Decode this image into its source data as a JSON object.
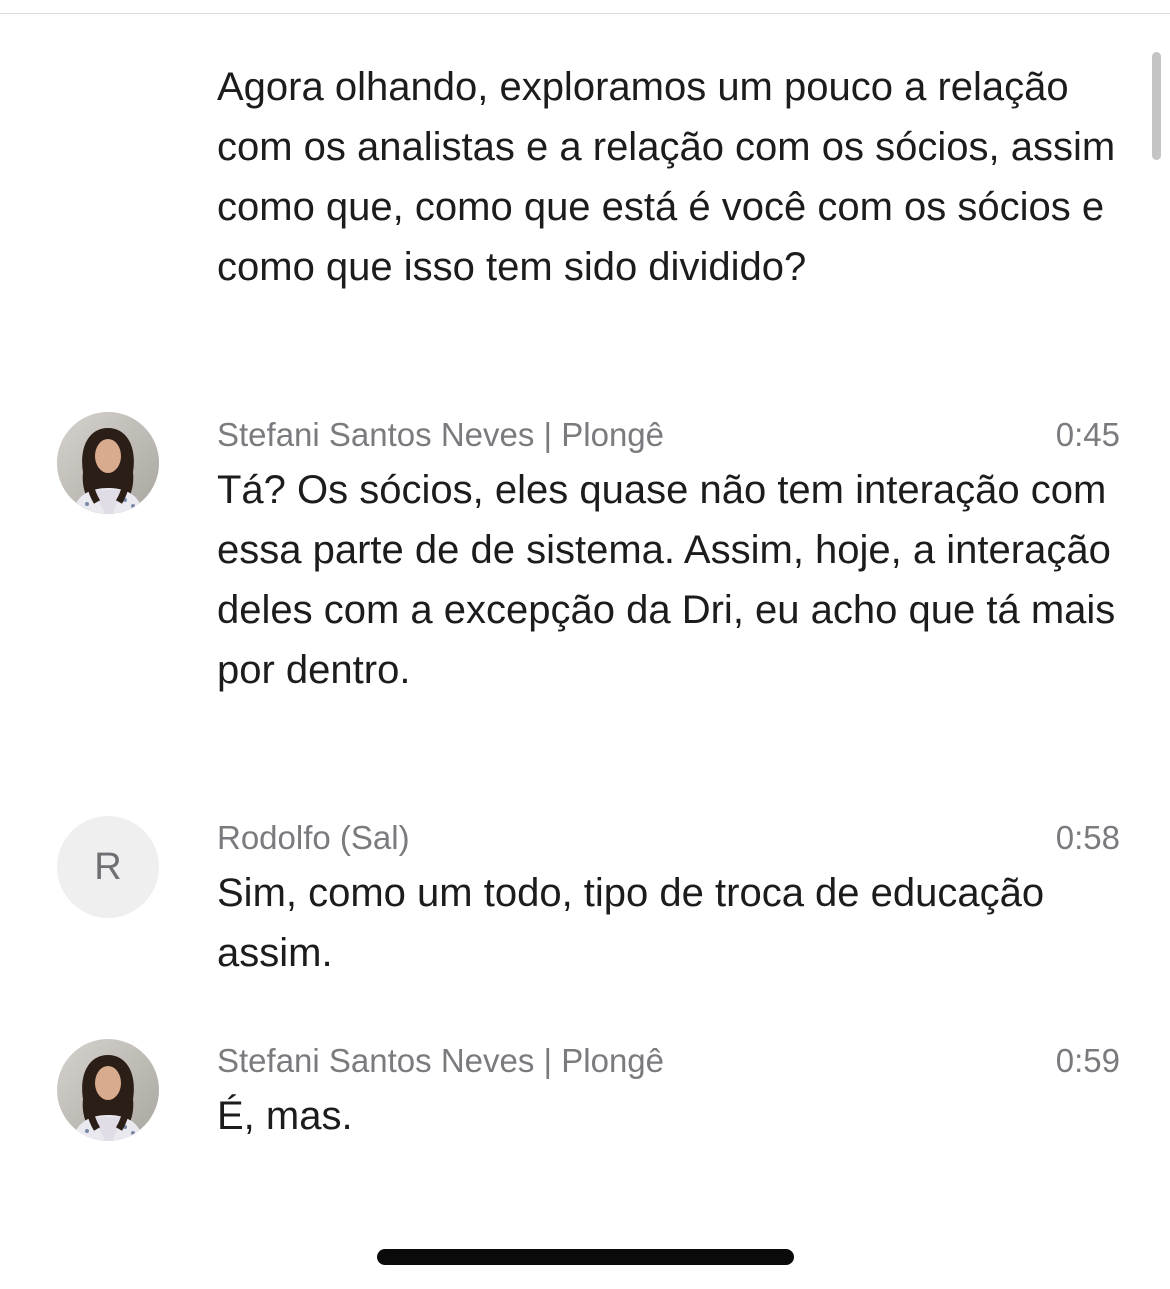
{
  "transcript": {
    "entries": [
      {
        "speaker": "",
        "time": "",
        "avatar": "none",
        "text": "Agora olhando, exploramos um pouco a relação com os analistas e a relação com os sócios, assim como que, como que está é você com os sócios e como que isso tem sido dividido?"
      },
      {
        "speaker": "Stefani Santos Neves | Plongê",
        "time": "0:45",
        "avatar": "photo",
        "text": "Tá? Os sócios, eles quase não tem interação com essa parte de de sistema. Assim, hoje, a interação deles com a excepção da Dri, eu acho que tá mais por dentro."
      },
      {
        "speaker": "Rodolfo (Sal)",
        "time": "0:58",
        "avatar": "initial",
        "avatar_initial": "R",
        "text": "Sim, como um todo, tipo de troca de educação assim."
      },
      {
        "speaker": "Stefani Santos Neves | Plongê",
        "time": "0:59",
        "avatar": "photo",
        "text": "É, mas."
      }
    ]
  },
  "colors": {
    "text": "#1c1c1e",
    "meta": "#7b7b7f",
    "avatar_bg": "#efefef",
    "scrollbar": "#c4c4c4",
    "home_indicator": "#0a0a0a"
  },
  "icons": {
    "avatar_photo": "person-photo-icon"
  }
}
